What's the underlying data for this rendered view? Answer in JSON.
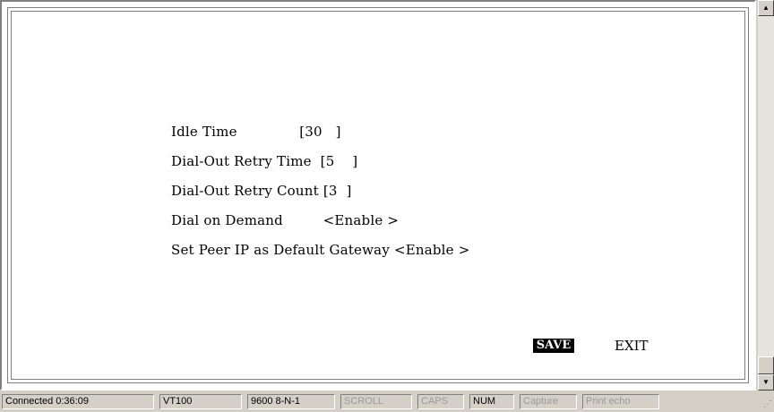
{
  "terminal": {
    "lines": [
      "Idle Time              [30   ]",
      "Dial-Out Retry Time  [5    ]",
      "Dial-Out Retry Count [3  ]",
      "Dial on Demand         <Enable >",
      "Set Peer IP as Default Gateway <Enable >"
    ],
    "fields": {
      "idle_time": {
        "label": "Idle Time",
        "value": "30"
      },
      "dial_out_retry_time": {
        "label": "Dial-Out Retry Time",
        "value": "5"
      },
      "dial_out_retry_count": {
        "label": "Dial-Out Retry Count",
        "value": "3"
      },
      "dial_on_demand": {
        "label": "Dial on Demand",
        "value": "Enable"
      },
      "set_peer_ip_default_gateway": {
        "label": "Set Peer IP as Default Gateway",
        "value": "Enable"
      }
    },
    "save_label": "SAVE",
    "exit_label": "EXIT"
  },
  "scrollbar": {
    "up_icon": "arrow-up-icon",
    "down_icon": "arrow-down-icon"
  },
  "statusbar": {
    "connected": "Connected 0:36:09",
    "emulation": "VT100",
    "port_settings": "9600 8-N-1",
    "scroll": "SCROLL",
    "caps": "CAPS",
    "num": "NUM",
    "capture": "Capture",
    "print_echo": "Print echo"
  },
  "colors": {
    "window_bg": "#d4d0c8",
    "terminal_bg": "#ffffff",
    "text": "#000000",
    "disabled_text": "#9a9a9a",
    "highlight_bg": "#000000",
    "highlight_text": "#ffffff"
  }
}
